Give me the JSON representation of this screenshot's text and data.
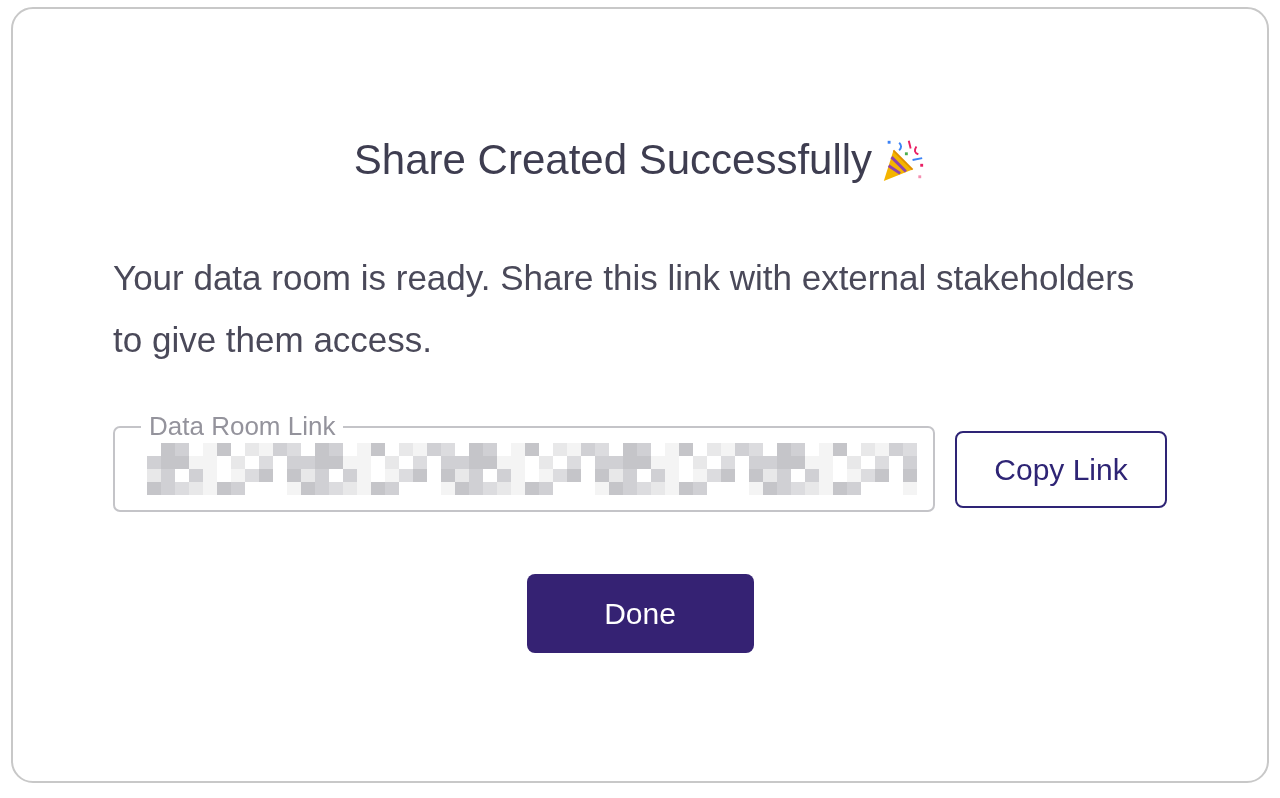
{
  "dialog": {
    "title": "Share Created Successfully",
    "message": "Your data room is ready. Share this link with external stakeholders to give them access.",
    "link_field": {
      "label": "Data Room Link",
      "value_obscured": true
    },
    "copy_button": {
      "label": "Copy Link"
    },
    "done_button": {
      "label": "Done"
    }
  }
}
